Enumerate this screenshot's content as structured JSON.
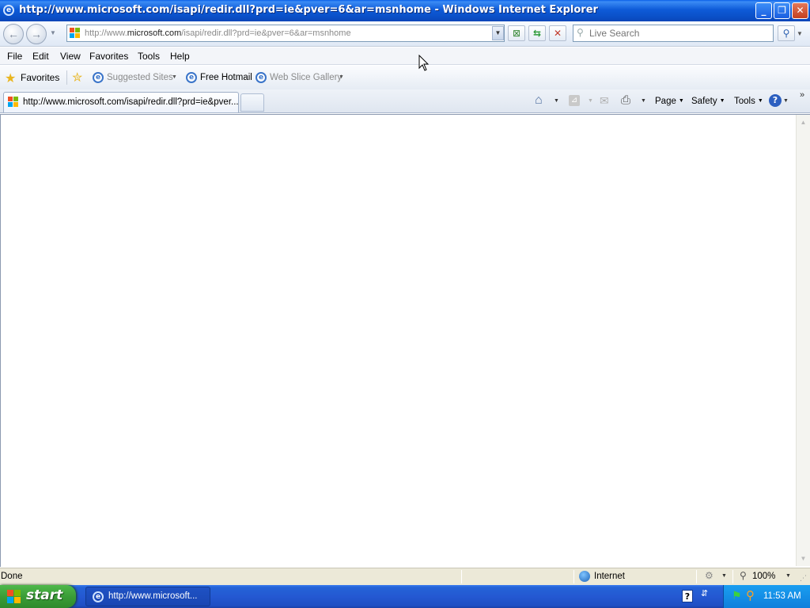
{
  "window": {
    "title": "http://www.microsoft.com/isapi/redir.dll?prd=ie&pver=6&ar=msnhome - Windows Internet Explorer",
    "minimize_glyph": "_",
    "restore_glyph": "❐",
    "close_glyph": "✕"
  },
  "navigation": {
    "back_glyph": "←",
    "forward_glyph": "→",
    "address": {
      "prefix": "http://www.",
      "domain": "microsoft.com",
      "suffix": "/isapi/redir.dll?prd=ie&pver=6&ar=msnhome"
    },
    "search_placeholder": "Live Search"
  },
  "menu": [
    "File",
    "Edit",
    "View",
    "Favorites",
    "Tools",
    "Help"
  ],
  "favorites_bar": {
    "favorites_label": "Favorites",
    "items": [
      {
        "label": "Suggested Sites",
        "disabled": true
      },
      {
        "label": "Free Hotmail",
        "disabled": false
      },
      {
        "label": "Web Slice Gallery",
        "disabled": true
      }
    ]
  },
  "tabs": [
    {
      "title": "http://www.microsoft.com/isapi/redir.dll?prd=ie&pver..."
    }
  ],
  "command_bar": {
    "page_label": "Page",
    "safety_label": "Safety",
    "tools_label": "Tools",
    "help_glyph": "?"
  },
  "status_bar": {
    "status_text": "Done",
    "zone_label": "Internet",
    "zoom": "100%"
  },
  "taskbar": {
    "start_label": "start",
    "task_title": "http://www.microsoft...",
    "clock": "11:53 AM"
  },
  "colors": {
    "titlebar": "#0a4fc7",
    "taskbar": "#2458d2",
    "start_button": "#3a9d37",
    "tray": "#0f7fdc"
  }
}
